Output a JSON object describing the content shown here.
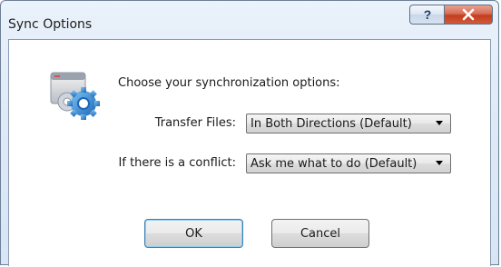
{
  "window": {
    "title": "Sync Options",
    "help_label": "?",
    "close_label": "X"
  },
  "dialog": {
    "heading": "Choose your synchronization options:",
    "transfer_label": "Transfer Files:",
    "transfer_value": "In Both Directions (Default)",
    "conflict_label": "If there is a conflict:",
    "conflict_value": "Ask me what to do (Default)"
  },
  "buttons": {
    "ok_label": "OK",
    "cancel_label": "Cancel"
  }
}
